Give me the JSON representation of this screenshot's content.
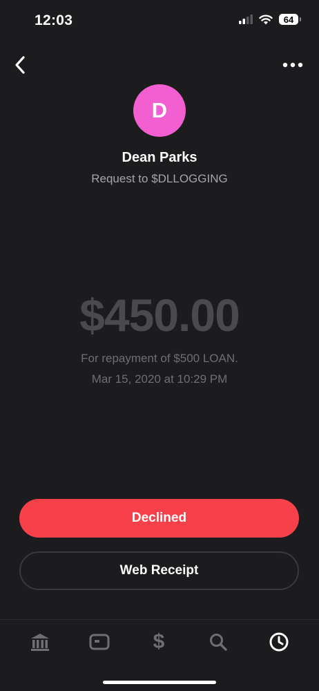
{
  "status_bar": {
    "time": "12:03",
    "battery": "64",
    "icons": [
      "signal-icon",
      "wifi-icon",
      "battery-icon"
    ]
  },
  "nav": {
    "back_icon": "chevron-left-icon",
    "more_icon": "more-horizontal-icon"
  },
  "profile": {
    "initial": "D",
    "avatar_color": "#f25fd0",
    "name": "Dean Parks",
    "subtitle": "Request to $DLLOGGING"
  },
  "payment": {
    "amount": "$450.00",
    "note": "For repayment of $500 LOAN.",
    "date": "Mar 15, 2020 at 10:29 PM"
  },
  "actions": {
    "declined_label": "Declined",
    "declined_color": "#f6404a",
    "receipt_label": "Web Receipt"
  },
  "tab_bar": {
    "tabs": [
      {
        "name": "banking",
        "icon": "bank-icon",
        "active": false
      },
      {
        "name": "card",
        "icon": "card-icon",
        "active": false
      },
      {
        "name": "money",
        "icon": "dollar-icon",
        "glyph": "$",
        "active": false
      },
      {
        "name": "search",
        "icon": "search-icon",
        "active": false
      },
      {
        "name": "activity",
        "icon": "clock-icon",
        "active": true
      }
    ]
  }
}
